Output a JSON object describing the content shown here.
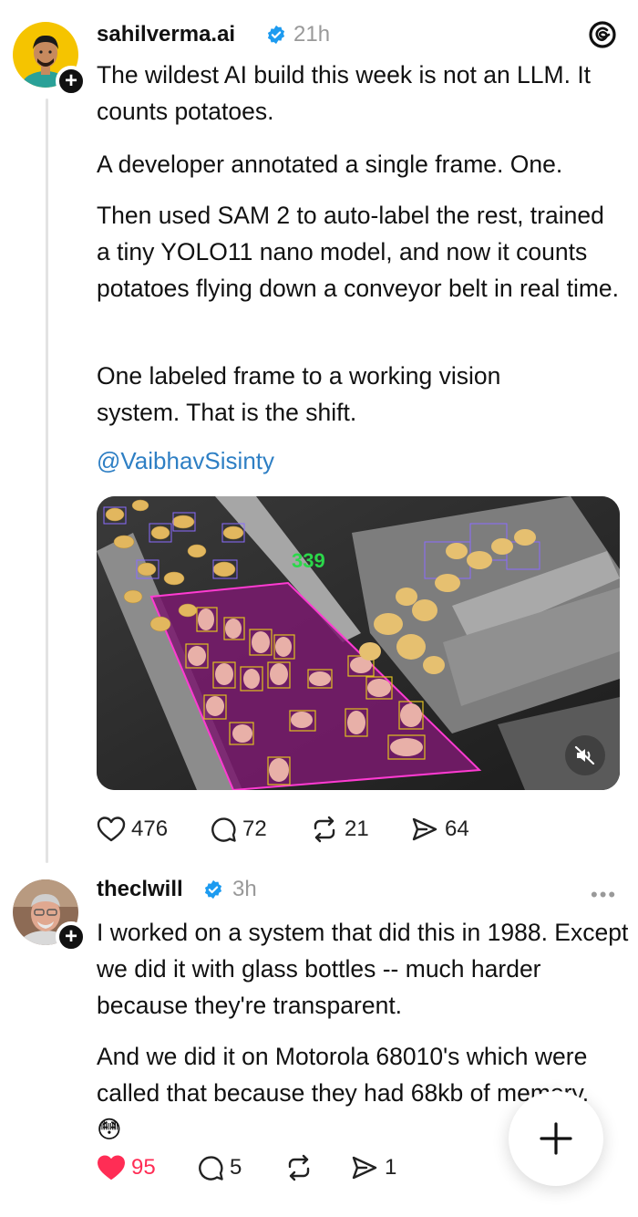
{
  "post1": {
    "username": "sahilverma.ai",
    "time": "21h",
    "paragraphs": [
      "The wildest AI build this week is not an LLM. It counts potatoes.",
      "A developer annotated a single frame. One.",
      "Then used SAM 2 to auto-label the rest, trained a tiny YOLO11 nano model, and now it counts potatoes flying down a conveyor belt in real time.",
      "One labeled frame to a working vision system. That is the shift."
    ],
    "mention": "@VaibhavSisinty",
    "video_counter": "339",
    "likes": "476",
    "replies": "72",
    "reposts": "21",
    "shares": "64"
  },
  "post2": {
    "username": "theclwill",
    "time": "3h",
    "paragraphs": [
      "I worked on a system that did this in 1988. Except we did it with glass bottles -- much harder because they're transparent.",
      "And we did it on Motorola 68010's which were called that because they had 68kb of memory. 😳"
    ],
    "likes": "95",
    "replies": "5",
    "reposts": "",
    "shares": "1"
  },
  "colors": {
    "verified": "#1d9bf0",
    "mention": "#2e7fc4",
    "like_active": "#ff2d55",
    "muted_text": "#999999"
  },
  "icons": [
    "threads-logo-icon",
    "verified-icon",
    "heart-icon",
    "comment-icon",
    "repost-icon",
    "share-icon",
    "mute-icon",
    "more-icon",
    "plus-icon"
  ]
}
